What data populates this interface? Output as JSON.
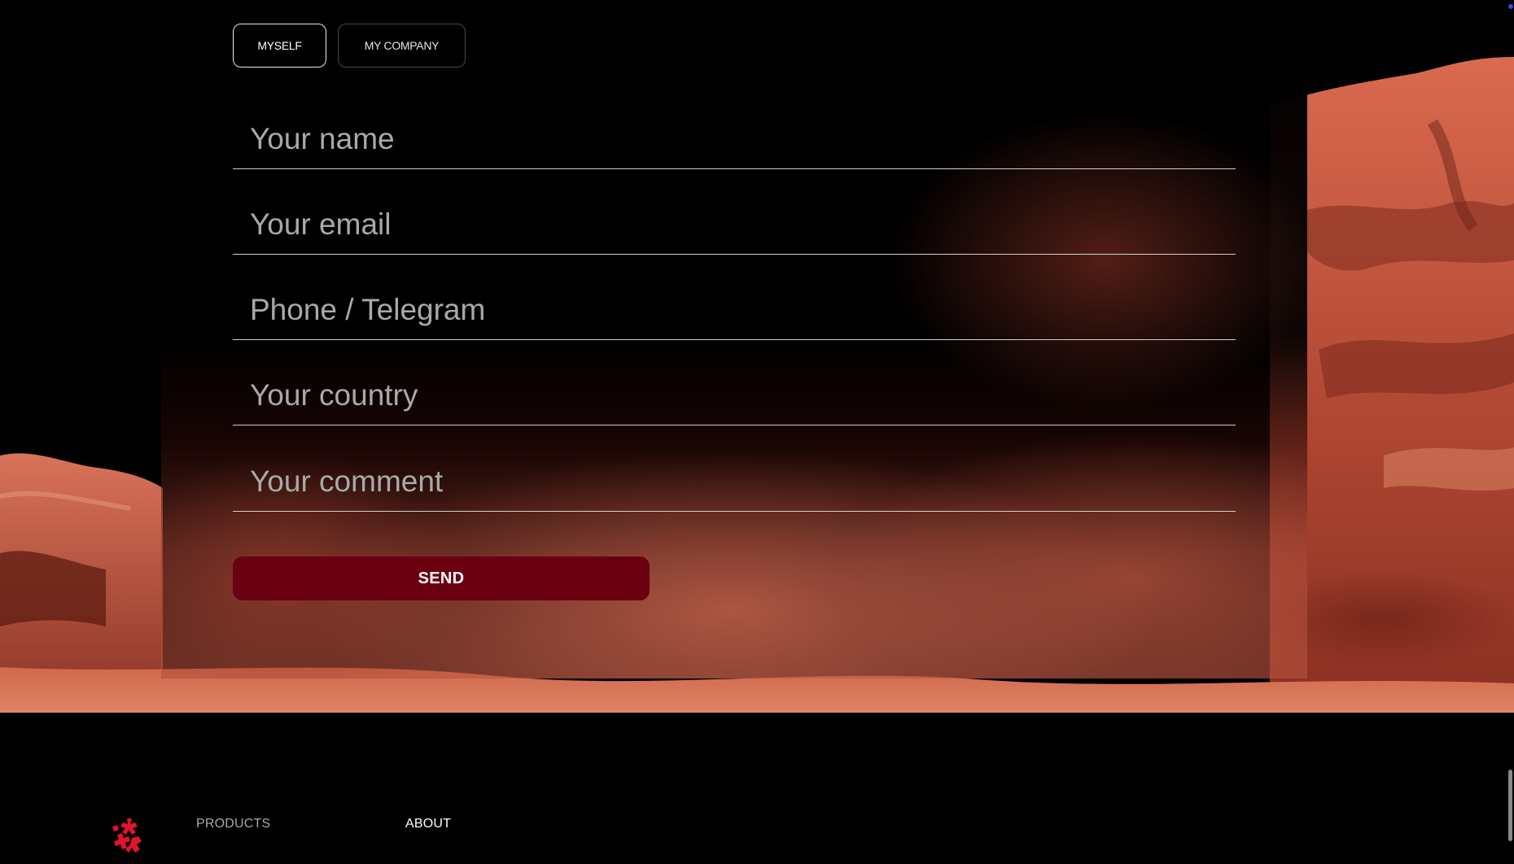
{
  "form": {
    "toggles": [
      {
        "label": "MYSELF",
        "active": true
      },
      {
        "label": "MY COMPANY",
        "active": false
      }
    ],
    "fields": {
      "name": {
        "placeholder": "Your name",
        "value": ""
      },
      "email": {
        "placeholder": "Your email",
        "value": ""
      },
      "phone": {
        "placeholder": "Phone / Telegram",
        "value": ""
      },
      "country": {
        "placeholder": "Your country",
        "value": ""
      },
      "comment": {
        "placeholder": "Your comment",
        "value": ""
      }
    },
    "send_label": "SEND"
  },
  "footer": {
    "logo_icon": "brand-logo-icon",
    "links": [
      {
        "label": "PRODUCTS"
      },
      {
        "label": "ABOUT"
      }
    ]
  },
  "colors": {
    "accent": "#6b0010",
    "logo": "#e0142a",
    "rock": "#c45a40"
  }
}
